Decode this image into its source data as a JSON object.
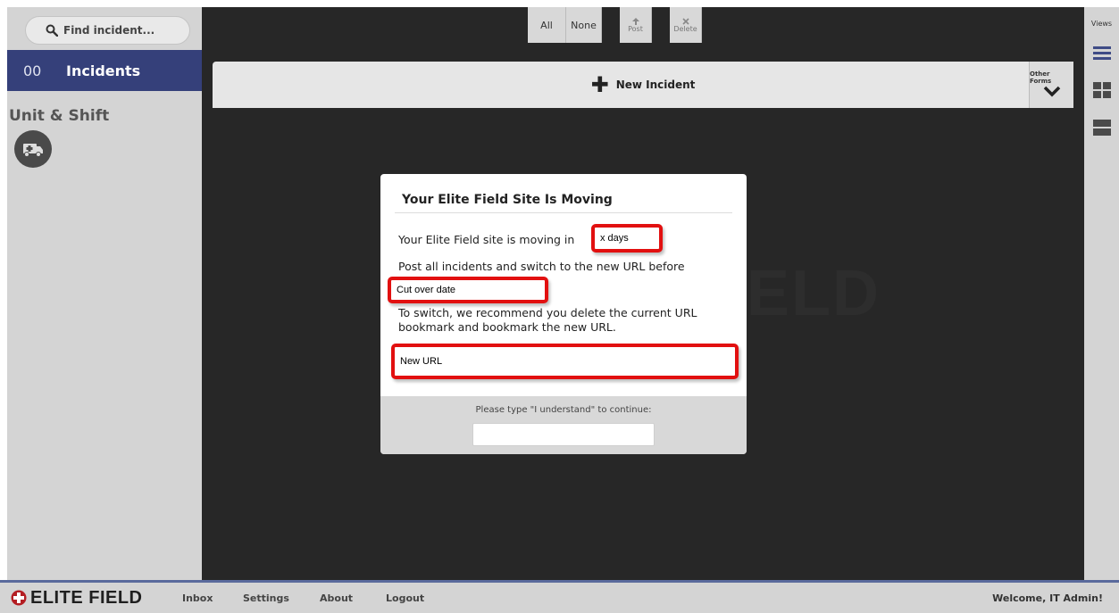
{
  "sidebar": {
    "search_placeholder": "Find incident...",
    "incidents_count": "00",
    "incidents_label": "Incidents",
    "unit_shift_label": "Unit & Shift",
    "icons": {
      "search": "search-icon",
      "ambulance": "ambulance-icon"
    }
  },
  "toolbar": {
    "all_label": "All",
    "none_label": "None",
    "post_label": "Post",
    "delete_label": "Delete"
  },
  "new_incident": {
    "label": "New Incident",
    "other_forms_label": "Other Forms"
  },
  "watermark": {
    "text": "ELD"
  },
  "views": {
    "title": "Views",
    "icons": [
      "list-view-icon",
      "grid-view-icon",
      "split-view-icon"
    ]
  },
  "modal": {
    "title": "Your Elite Field Site Is Moving",
    "moving_prefix": "Your Elite Field site is moving in",
    "days_value": "x days",
    "post_text": "Post all incidents and switch to the new URL before",
    "cutover_value": "Cut over date",
    "switch_line_1": "To switch, we recommend you delete the current URL",
    "switch_line_2": "bookmark and bookmark the new URL.",
    "new_url_value": "New URL",
    "prompt": "Please type \"I understand\" to continue:",
    "input_value": ""
  },
  "footer": {
    "brand": "ELITE FIELD",
    "links": [
      "Inbox",
      "Settings",
      "About",
      "Logout"
    ],
    "welcome": "Welcome, IT Admin!"
  },
  "colors": {
    "incidents_bar": "#35407a",
    "main_bg": "#272727",
    "highlight_red": "#e21010",
    "brand_red": "#b41e23"
  }
}
